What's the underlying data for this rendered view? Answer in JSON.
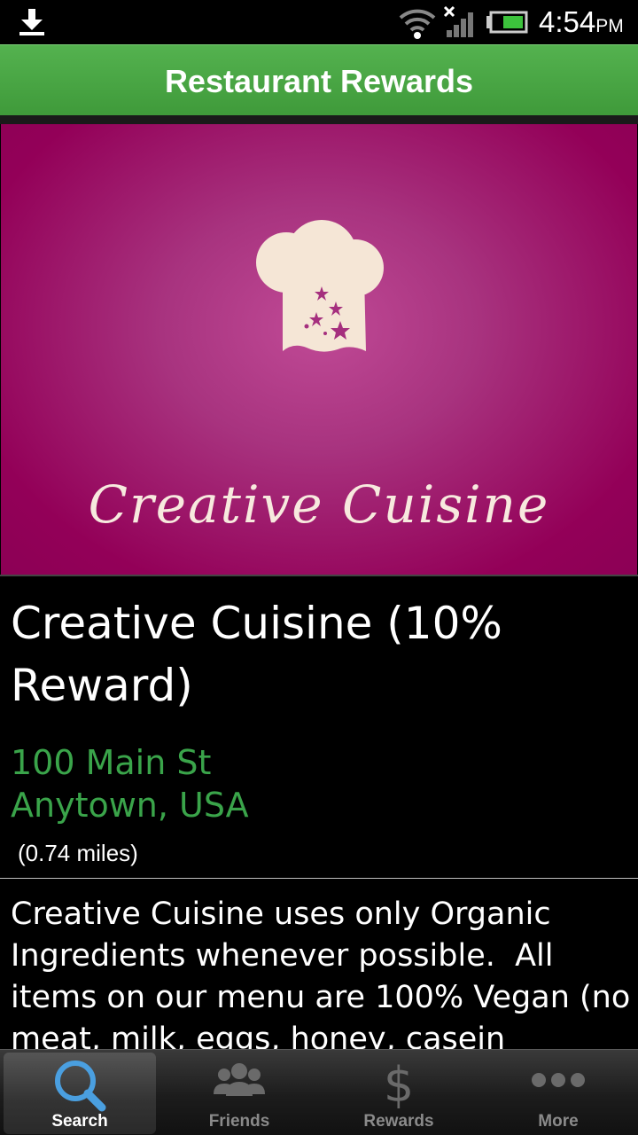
{
  "status_bar": {
    "time": "4:54",
    "ampm": "PM",
    "icons": [
      "download-icon",
      "wifi-icon",
      "signal-icon",
      "battery-icon"
    ]
  },
  "action_bar": {
    "title": "Restaurant Rewards",
    "color": "#4aa845"
  },
  "hero": {
    "logo_text": "Creative Cuisine",
    "background": "#9a0a62"
  },
  "restaurant": {
    "name": "Creative Cuisine (10% Reward)",
    "address_line1": "100 Main St",
    "address_line2": "Anytown, USA",
    "distance": "(0.74 miles)",
    "description": "Creative Cuisine uses only Organic Ingredients whenever possible.  All items on our menu are 100% Vegan (no meat, milk, eggs, honey, casein"
  },
  "tabs": [
    {
      "label": "Search",
      "icon": "search-icon",
      "active": true
    },
    {
      "label": "Friends",
      "icon": "friends-icon",
      "active": false
    },
    {
      "label": "Rewards",
      "icon": "dollar-icon",
      "active": false
    },
    {
      "label": "More",
      "icon": "more-icon",
      "active": false
    }
  ],
  "colors": {
    "accent_green": "#3aa44a",
    "tab_active_icon": "#4a9fe0"
  }
}
